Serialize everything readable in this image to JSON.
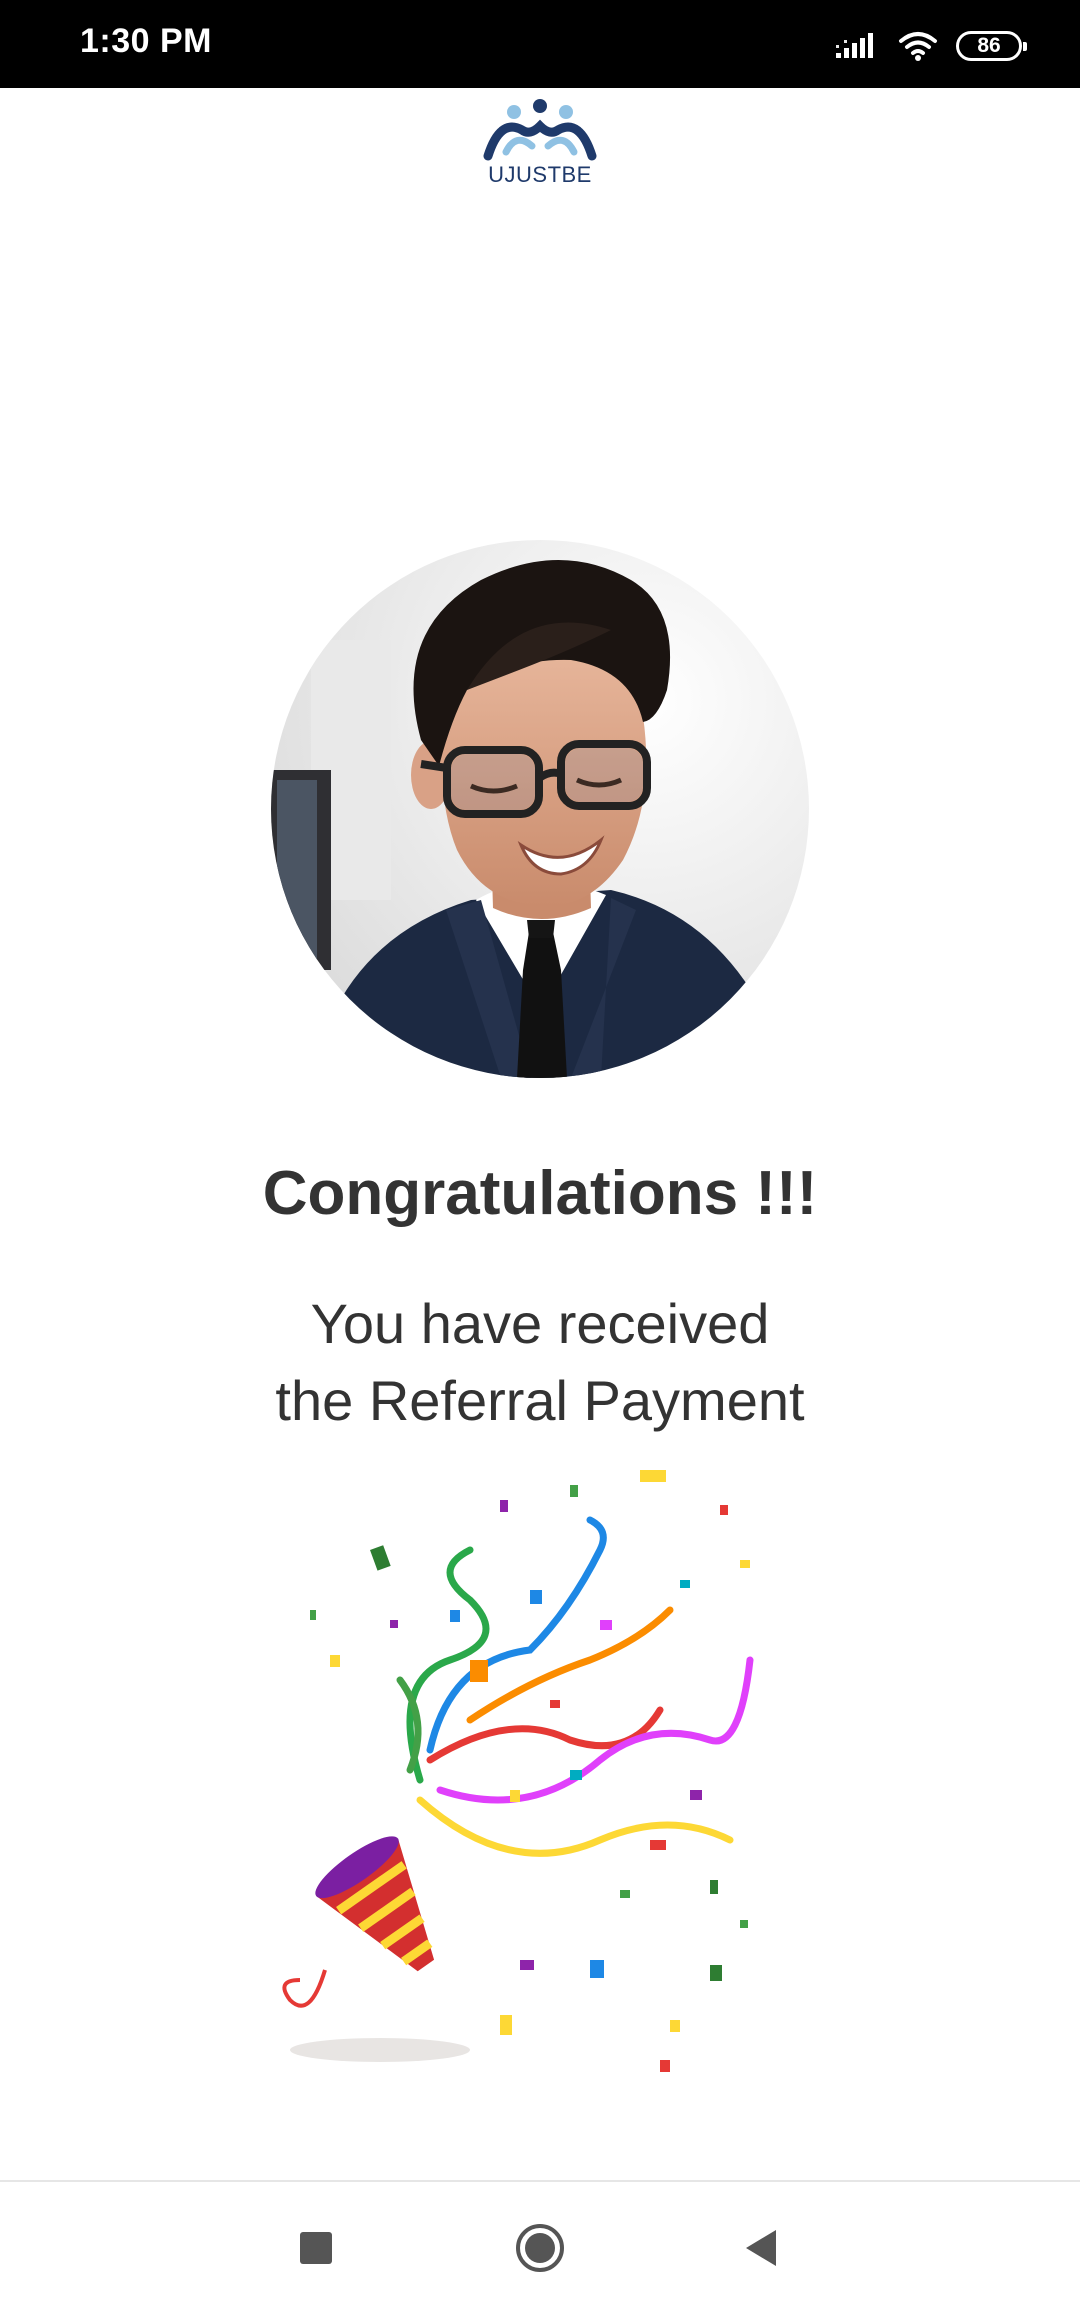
{
  "status_bar": {
    "time": "1:30 PM",
    "battery": "86",
    "icons": [
      "signal-icon",
      "wifi-icon",
      "battery-icon"
    ]
  },
  "app": {
    "logo_text": "UJUSTBE"
  },
  "main": {
    "title": "Congratulations !!!",
    "message_line1": "You have received",
    "message_line2": "the Referral Payment"
  },
  "nav_bar": {
    "buttons": [
      "recent-apps-button",
      "home-button",
      "back-button"
    ]
  },
  "colors": {
    "text": "#333333",
    "logo_blue": "#1f3a6b",
    "logo_light_blue": "#8fc1e3",
    "status_bar": "#000000"
  }
}
